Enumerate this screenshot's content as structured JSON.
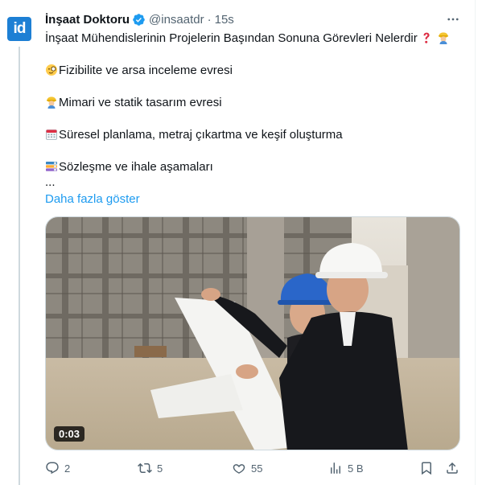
{
  "tweet": {
    "avatar_text": "id",
    "author_name": "İnşaat Doktoru",
    "handle": "@insaatdr",
    "separator": "·",
    "time": "15s",
    "more_icon": "ellipsis-icon",
    "lines": {
      "title": "İnşaat Mühendislerinin Projelerin Başından Sonuna Görevleri Nelerdir",
      "item1": "Fizibilite ve arsa inceleme evresi",
      "item2": "Mimari ve statik tasarım evresi",
      "item3": "Süresel planlama, metraj çıkartma ve keşif oluşturma",
      "item4": "Sözleşme ve ihale aşamaları",
      "ellipsis": "...",
      "show_more": "Daha fazla göster"
    },
    "media": {
      "duration": "0:03"
    },
    "actions": {
      "replies": "2",
      "reposts": "5",
      "likes": "55",
      "views": "5 B"
    },
    "colors": {
      "accent": "#1d9bf0",
      "secondary_text": "#536471",
      "verified": "#1d9bf0",
      "avatar": "#1d7fd4"
    }
  }
}
